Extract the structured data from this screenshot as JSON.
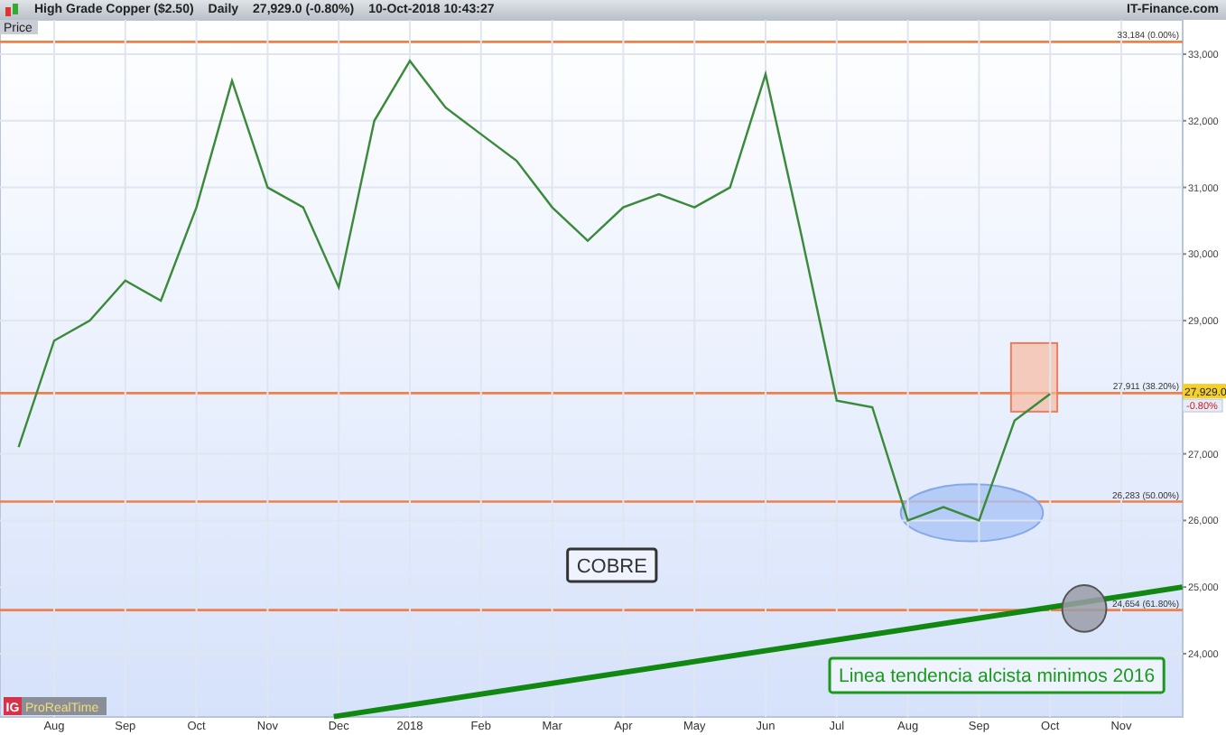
{
  "header": {
    "instrument": "High Grade Copper ($2.50)",
    "timeframe": "Daily",
    "last": "27,929.0 (-0.80%)",
    "timestamp": "10-Oct-2018 10:43:27",
    "source": "IT-Finance.com"
  },
  "chart": {
    "panel_label": "Price",
    "last_price_badge": "27,929.0",
    "change_badge": "-0.80%",
    "logo": {
      "mark": "IG",
      "name": "ProRealTime"
    },
    "chart_data": {
      "type": "line",
      "ylim": [
        23050,
        33515
      ],
      "grid": true,
      "categories": [
        null,
        "Aug",
        null,
        "Sep",
        null,
        "Oct",
        null,
        "Nov",
        null,
        "Dec",
        null,
        "2018",
        null,
        "Feb",
        null,
        "Mar",
        null,
        "Apr",
        null,
        "May",
        null,
        "Jun",
        null,
        "Jul",
        null,
        "Aug",
        null,
        "Sep",
        null,
        "Oct",
        null,
        "Nov"
      ],
      "series": [
        {
          "color": "#3a8a3a",
          "values": [
            27100,
            28700,
            29000,
            29600,
            29300,
            30700,
            32600,
            31000,
            30700,
            29500,
            32000,
            32900,
            32200,
            31800,
            31400,
            30700,
            30200,
            30700,
            30900,
            30700,
            31000,
            32700,
            30300,
            27800,
            27700,
            26000,
            26200,
            26000,
            27500,
            27900,
            null,
            null
          ]
        }
      ],
      "yticks": [
        {
          "value": 24000,
          "label": "24,000"
        },
        {
          "value": 25000,
          "label": "25,000"
        },
        {
          "value": 26000,
          "label": "26,000"
        },
        {
          "value": 27000,
          "label": "27,000"
        },
        {
          "value": 29000,
          "label": "29,000"
        },
        {
          "value": 30000,
          "label": "30,000"
        },
        {
          "value": 31000,
          "label": "31,000"
        },
        {
          "value": 32000,
          "label": "32,000"
        },
        {
          "value": 33000,
          "label": "33,000"
        }
      ]
    },
    "drawings": [
      {
        "kind": "hline",
        "label": "33,184 (0.00%)"
      },
      {
        "kind": "hline",
        "label": "27,911 (38.20%)"
      },
      {
        "kind": "hline",
        "label": "26,283 (50.00%)"
      },
      {
        "kind": "hline",
        "label": "24,654 (61.80%)"
      },
      {
        "kind": "trendline"
      },
      {
        "kind": "ellipse"
      },
      {
        "kind": "rect"
      },
      {
        "kind": "circle"
      },
      {
        "kind": "text",
        "text": "COBRE",
        "color": "#333333"
      },
      {
        "kind": "text",
        "text": "Linea tendencia alcista minimos 2016",
        "color": "#1a9a1a"
      }
    ]
  }
}
